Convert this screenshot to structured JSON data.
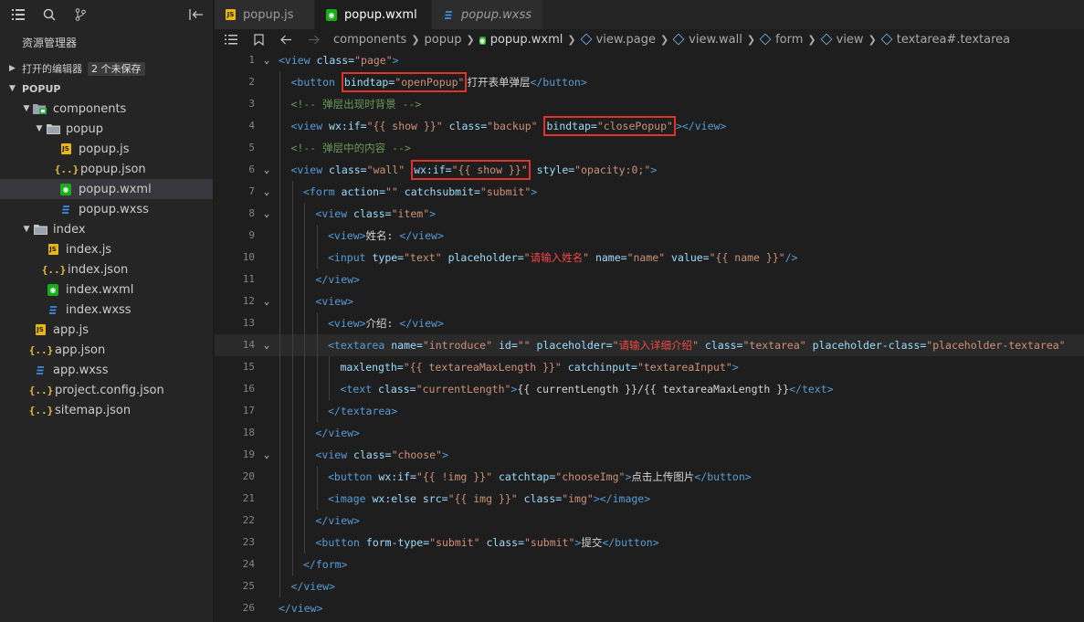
{
  "sidebar": {
    "explorer_title": "资源管理器",
    "open_editors_label": "打开的编辑器",
    "open_editors_badge": "2 个未保存",
    "project_label": "POPUP",
    "tree": [
      {
        "label": "components",
        "kind": "folder-special",
        "depth": 1,
        "twisty": "open"
      },
      {
        "label": "popup",
        "kind": "folder",
        "depth": 2,
        "twisty": "open"
      },
      {
        "label": "popup.js",
        "kind": "js",
        "depth": 3
      },
      {
        "label": "popup.json",
        "kind": "json",
        "depth": 3
      },
      {
        "label": "popup.wxml",
        "kind": "wxml",
        "depth": 3,
        "selected": true
      },
      {
        "label": "popup.wxss",
        "kind": "wxss",
        "depth": 3
      },
      {
        "label": "index",
        "kind": "folder",
        "depth": 1,
        "twisty": "open"
      },
      {
        "label": "index.js",
        "kind": "js",
        "depth": 2
      },
      {
        "label": "index.json",
        "kind": "json",
        "depth": 2
      },
      {
        "label": "index.wxml",
        "kind": "wxml",
        "depth": 2
      },
      {
        "label": "index.wxss",
        "kind": "wxss",
        "depth": 2
      },
      {
        "label": "app.js",
        "kind": "js",
        "depth": 1
      },
      {
        "label": "app.json",
        "kind": "json",
        "depth": 1
      },
      {
        "label": "app.wxss",
        "kind": "wxss",
        "depth": 1
      },
      {
        "label": "project.config.json",
        "kind": "json",
        "depth": 1
      },
      {
        "label": "sitemap.json",
        "kind": "json",
        "depth": 1
      }
    ]
  },
  "tabs": [
    {
      "label": "popup.js",
      "kind": "js",
      "active": false,
      "dirty": true
    },
    {
      "label": "popup.wxml",
      "kind": "wxml",
      "active": true,
      "dirty": true
    },
    {
      "label": "popup.wxss",
      "kind": "wxss",
      "active": false,
      "dirty": false
    }
  ],
  "breadcrumb": [
    "components",
    "popup",
    "popup.wxml",
    "view.page",
    "view.wall",
    "form",
    "view",
    "textarea#.textarea"
  ],
  "editor": {
    "current_line": 14,
    "lines": [
      {
        "n": "1",
        "fold": "v",
        "indent": 0,
        "tokens": [
          [
            "tag",
            "<view "
          ],
          [
            "attr",
            "class="
          ],
          [
            "str",
            "\"page\""
          ],
          [
            "tag",
            ">"
          ]
        ]
      },
      {
        "n": "2",
        "fold": "",
        "indent": 1,
        "tokens": [
          [
            "tag",
            "<button "
          ],
          [
            "hl-open",
            ""
          ],
          [
            "attr",
            "bindtap="
          ],
          [
            "str",
            "\"openPopup\""
          ],
          [
            "hl-close",
            ""
          ],
          [
            "txt",
            "打开表单弹层"
          ],
          [
            "tag",
            "</button>"
          ]
        ]
      },
      {
        "n": "3",
        "fold": "",
        "indent": 1,
        "tokens": [
          [
            "cm",
            "<!-- 弹层出现时背景 -->"
          ]
        ]
      },
      {
        "n": "4",
        "fold": "",
        "indent": 1,
        "tokens": [
          [
            "tag",
            "<view "
          ],
          [
            "attr",
            "wx:if="
          ],
          [
            "str",
            "\"{{ show }}\" "
          ],
          [
            "attr",
            "class="
          ],
          [
            "str",
            "\"backup\" "
          ],
          [
            "hl-open",
            ""
          ],
          [
            "attr",
            "bindtap="
          ],
          [
            "str",
            "\"closePopup\""
          ],
          [
            "hl-close",
            ""
          ],
          [
            "tag",
            "></view>"
          ]
        ]
      },
      {
        "n": "5",
        "fold": "",
        "indent": 1,
        "tokens": [
          [
            "cm",
            "<!-- 弹层中的内容 -->"
          ]
        ]
      },
      {
        "n": "6",
        "fold": "v",
        "indent": 1,
        "tokens": [
          [
            "tag",
            "<view "
          ],
          [
            "attr",
            "class="
          ],
          [
            "str",
            "\"wall\" "
          ],
          [
            "hl-open",
            ""
          ],
          [
            "attr",
            "wx:if="
          ],
          [
            "str",
            "\"{{ show }}\""
          ],
          [
            "hl-close",
            ""
          ],
          [
            "attr",
            " style="
          ],
          [
            "str",
            "\"opacity:0;\""
          ],
          [
            "tag",
            ">"
          ]
        ]
      },
      {
        "n": "7",
        "fold": "v",
        "indent": 2,
        "tokens": [
          [
            "tag",
            "<form "
          ],
          [
            "attr",
            "action="
          ],
          [
            "str",
            "\"\" "
          ],
          [
            "attr",
            "catchsubmit="
          ],
          [
            "str",
            "\"submit\""
          ],
          [
            "tag",
            ">"
          ]
        ]
      },
      {
        "n": "8",
        "fold": "v",
        "indent": 3,
        "tokens": [
          [
            "tag",
            "<view "
          ],
          [
            "attr",
            "class="
          ],
          [
            "str",
            "\"item\""
          ],
          [
            "tag",
            ">"
          ]
        ]
      },
      {
        "n": "9",
        "fold": "",
        "indent": 4,
        "tokens": [
          [
            "tag",
            "<view>"
          ],
          [
            "txt",
            "姓名: "
          ],
          [
            "tag",
            "</view>"
          ]
        ]
      },
      {
        "n": "10",
        "fold": "",
        "indent": 4,
        "tokens": [
          [
            "tag",
            "<input "
          ],
          [
            "attr",
            "type="
          ],
          [
            "str",
            "\"text\" "
          ],
          [
            "attr",
            "placeholder="
          ],
          [
            "str",
            "\""
          ],
          [
            "red",
            "请输入姓名"
          ],
          [
            "str",
            "\" "
          ],
          [
            "attr",
            "name="
          ],
          [
            "str",
            "\"name\" "
          ],
          [
            "attr",
            "value="
          ],
          [
            "str",
            "\"{{ name }}\""
          ],
          [
            "tag",
            "/>"
          ]
        ]
      },
      {
        "n": "11",
        "fold": "",
        "indent": 3,
        "tokens": [
          [
            "tag",
            "</view>"
          ]
        ]
      },
      {
        "n": "12",
        "fold": "v",
        "indent": 3,
        "tokens": [
          [
            "tag",
            "<view>"
          ]
        ]
      },
      {
        "n": "13",
        "fold": "",
        "indent": 4,
        "tokens": [
          [
            "tag",
            "<view>"
          ],
          [
            "txt",
            "介绍: "
          ],
          [
            "tag",
            "</view>"
          ]
        ]
      },
      {
        "n": "14",
        "fold": "v",
        "indent": 4,
        "tokens": [
          [
            "tag",
            "<textarea "
          ],
          [
            "attr",
            "name="
          ],
          [
            "str",
            "\"introduce\" "
          ],
          [
            "attr",
            "id="
          ],
          [
            "str",
            "\"\" "
          ],
          [
            "attr",
            "placeholder="
          ],
          [
            "str",
            "\""
          ],
          [
            "red",
            "请输入详细介绍"
          ],
          [
            "str",
            "\" "
          ],
          [
            "attr",
            "class="
          ],
          [
            "str",
            "\"textarea\" "
          ],
          [
            "attr",
            "placeholder-class="
          ],
          [
            "str",
            "\"placeholder-textarea\""
          ]
        ]
      },
      {
        "n": "15",
        "fold": "",
        "indent": 5,
        "tokens": [
          [
            "attr",
            "maxlength="
          ],
          [
            "str",
            "\"{{ textareaMaxLength }}\" "
          ],
          [
            "attr",
            "catchinput="
          ],
          [
            "str",
            "\"textareaInput\""
          ],
          [
            "tag",
            ">"
          ]
        ]
      },
      {
        "n": "16",
        "fold": "",
        "indent": 5,
        "tokens": [
          [
            "tag",
            "<text "
          ],
          [
            "attr",
            "class="
          ],
          [
            "str",
            "\"currentLength\""
          ],
          [
            "tag",
            ">"
          ],
          [
            "txt",
            "{{ currentLength }}/{{ textareaMaxLength }}"
          ],
          [
            "tag",
            "</text>"
          ]
        ]
      },
      {
        "n": "17",
        "fold": "",
        "indent": 4,
        "tokens": [
          [
            "tag",
            "</textarea>"
          ]
        ]
      },
      {
        "n": "18",
        "fold": "",
        "indent": 3,
        "tokens": [
          [
            "tag",
            "</view>"
          ]
        ]
      },
      {
        "n": "19",
        "fold": "v",
        "indent": 3,
        "tokens": [
          [
            "tag",
            "<view "
          ],
          [
            "attr",
            "class="
          ],
          [
            "str",
            "\"choose\""
          ],
          [
            "tag",
            ">"
          ]
        ]
      },
      {
        "n": "20",
        "fold": "",
        "indent": 4,
        "tokens": [
          [
            "tag",
            "<button "
          ],
          [
            "attr",
            "wx:if="
          ],
          [
            "str",
            "\"{{ !img }}\" "
          ],
          [
            "attr",
            "catchtap="
          ],
          [
            "str",
            "\"chooseImg\""
          ],
          [
            "tag",
            ">"
          ],
          [
            "txt",
            "点击上传图片"
          ],
          [
            "tag",
            "</button>"
          ]
        ]
      },
      {
        "n": "21",
        "fold": "",
        "indent": 4,
        "tokens": [
          [
            "tag",
            "<image "
          ],
          [
            "attr",
            "wx:else "
          ],
          [
            "attr",
            "src="
          ],
          [
            "str",
            "\"{{ img }}\" "
          ],
          [
            "attr",
            "class="
          ],
          [
            "str",
            "\"img\""
          ],
          [
            "tag",
            "></image>"
          ]
        ]
      },
      {
        "n": "22",
        "fold": "",
        "indent": 3,
        "tokens": [
          [
            "tag",
            "</view>"
          ]
        ]
      },
      {
        "n": "23",
        "fold": "",
        "indent": 3,
        "tokens": [
          [
            "tag",
            "<button "
          ],
          [
            "attr",
            "form-type="
          ],
          [
            "str",
            "\"submit\" "
          ],
          [
            "attr",
            "class="
          ],
          [
            "str",
            "\"submit\""
          ],
          [
            "tag",
            ">"
          ],
          [
            "txt",
            "提交"
          ],
          [
            "tag",
            "</button>"
          ]
        ]
      },
      {
        "n": "24",
        "fold": "",
        "indent": 2,
        "tokens": [
          [
            "tag",
            "</form>"
          ]
        ]
      },
      {
        "n": "25",
        "fold": "",
        "indent": 1,
        "tokens": [
          [
            "tag",
            "</view>"
          ]
        ]
      },
      {
        "n": "26",
        "fold": "",
        "indent": 0,
        "tokens": [
          [
            "tag",
            "</view>"
          ]
        ]
      }
    ]
  },
  "icons": {
    "explorer": "files-icon",
    "search": "search-icon",
    "source_control": "source-control-icon",
    "collapse": "collapse-panel-icon",
    "outline": "list-icon",
    "bookmark": "bookmark-icon",
    "back": "arrow-left-icon",
    "forward": "arrow-right-icon"
  },
  "colors": {
    "highlight_box": "#e0332a",
    "tag": "#569cd6",
    "attr": "#9cdcfe",
    "string": "#ce9178",
    "comment": "#6a9955"
  }
}
